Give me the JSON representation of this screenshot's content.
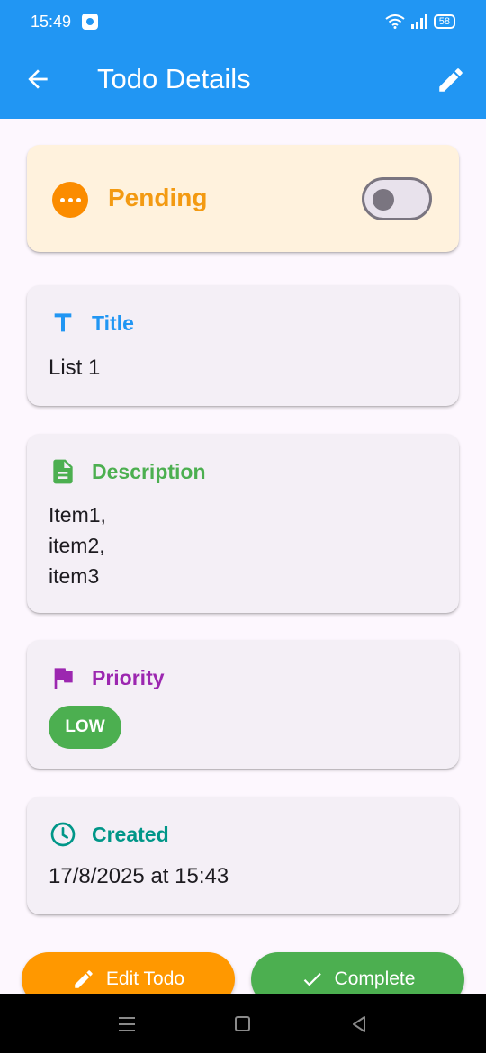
{
  "status_bar": {
    "time": "15:49",
    "battery": "58"
  },
  "app_bar": {
    "title": "Todo Details"
  },
  "status_card": {
    "label": "Pending",
    "completed_toggle_on": false
  },
  "title_field": {
    "label": "Title",
    "value": "List 1"
  },
  "description_field": {
    "label": "Description",
    "lines": [
      "Item1,",
      "item2,",
      "item3"
    ]
  },
  "priority_field": {
    "label": "Priority",
    "chip": "LOW"
  },
  "created_field": {
    "label": "Created",
    "value": "17/8/2025 at 15:43"
  },
  "actions": {
    "edit_label": "Edit Todo",
    "complete_label": "Complete"
  },
  "colors": {
    "primary": "#2196f3",
    "pending": "#f39a12",
    "title": "#2196f3",
    "description": "#4caf50",
    "priority": "#9c27b0",
    "created": "#009688",
    "edit_button": "#ff9800",
    "complete_button": "#4caf50"
  },
  "icons": [
    "back-arrow-icon",
    "pencil-icon",
    "more-dots-icon",
    "text-t-icon",
    "document-icon",
    "flag-icon",
    "clock-icon",
    "check-icon"
  ]
}
